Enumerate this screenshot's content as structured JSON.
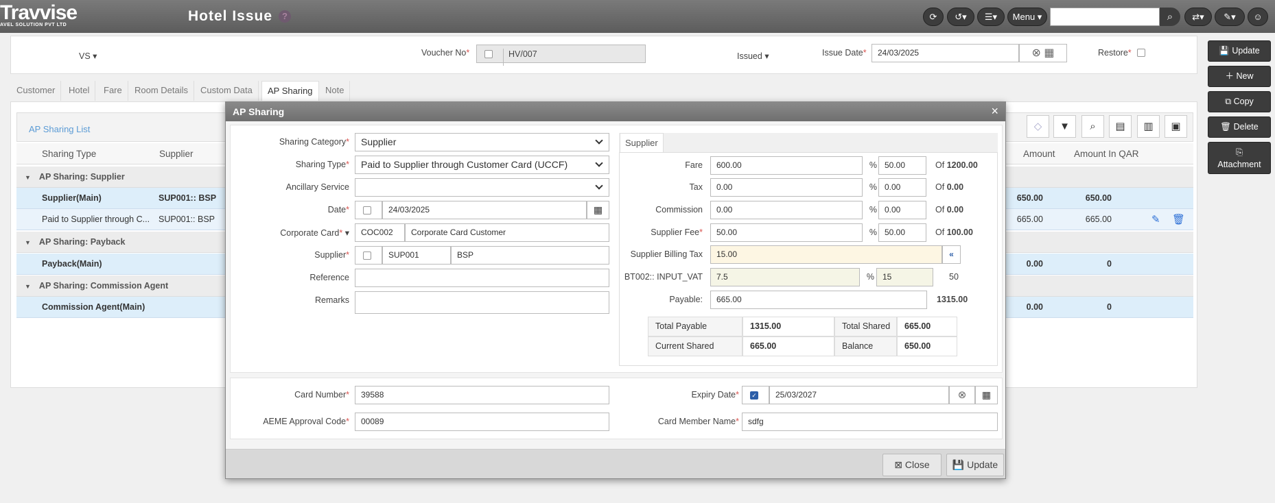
{
  "app": {
    "logo": "Travvise",
    "logo_sub": "AVEL SOLUTION PVT LTD",
    "title": "Hotel Issue",
    "help": "?",
    "menu_label": "Menu"
  },
  "header": {
    "vs": "VS",
    "voucher_label": "Voucher No",
    "voucher_value": "HV/007",
    "status": "Issued",
    "issue_date_label": "Issue Date",
    "issue_date": "24/03/2025",
    "restore_label": "Restore"
  },
  "tabs": [
    "Customer",
    "Hotel",
    "Fare",
    "Room Details",
    "Custom Data",
    "AP Sharing",
    "Note"
  ],
  "list": {
    "title": "AP Sharing List",
    "columns": [
      "Sharing Type",
      "Supplier",
      "Amount",
      "Amount In QAR"
    ],
    "groups": [
      {
        "label": "AP Sharing: Supplier"
      },
      {
        "label": "AP Sharing: Payback"
      },
      {
        "label": "AP Sharing: Commission Agent"
      }
    ],
    "rows": [
      {
        "type": "Supplier(Main)",
        "supplier": "SUP001:: BSP",
        "amount": "650.00",
        "qar": "650.00"
      },
      {
        "type": "Paid to Supplier through C...",
        "supplier": "SUP001:: BSP",
        "amount": "665.00",
        "qar": "665.00"
      },
      {
        "type": "Payback(Main)",
        "supplier": "",
        "amount": "0.00",
        "qar": "0"
      },
      {
        "type": "Commission Agent(Main)",
        "supplier": "",
        "amount": "0.00",
        "qar": "0"
      }
    ]
  },
  "side_buttons": {
    "update": "Update",
    "new": "New",
    "copy": "Copy",
    "delete": "Delete",
    "attachment": "Attachment"
  },
  "modal": {
    "title": "AP Sharing",
    "close_x": "×",
    "left": {
      "sharing_category_label": "Sharing Category",
      "sharing_category": "Supplier",
      "sharing_type_label": "Sharing Type",
      "sharing_type": "Paid to Supplier through Customer Card (UCCF)",
      "ancillary_label": "Ancillary Service",
      "ancillary": "",
      "date_label": "Date",
      "date": "24/03/2025",
      "corp_card_label": "Corporate Card",
      "corp_card_code": "COC002",
      "corp_card_name": "Corporate Card Customer",
      "supplier_label": "Supplier",
      "supplier_code": "SUP001",
      "supplier_name": "BSP",
      "reference_label": "Reference",
      "reference": "",
      "remarks_label": "Remarks",
      "remarks": ""
    },
    "right": {
      "tab": "Supplier",
      "fare_label": "Fare",
      "fare": "600.00",
      "fare_pct": "50.00",
      "fare_of": "1200.00",
      "tax_label": "Tax",
      "tax": "0.00",
      "tax_pct": "0.00",
      "tax_of": "0.00",
      "commission_label": "Commission",
      "commission": "0.00",
      "commission_pct": "0.00",
      "commission_of": "0.00",
      "supfee_label": "Supplier Fee",
      "supfee": "50.00",
      "supfee_pct": "50.00",
      "supfee_of": "100.00",
      "billing_tax_label": "Supplier Billing Tax",
      "billing_tax": "15.00",
      "vat_label": "BT002:: INPUT_VAT",
      "vat": "7.5",
      "vat_pct": "15",
      "vat_of": "50",
      "payable_label": "Payable:",
      "payable": "665.00",
      "payable_total": "1315.00",
      "of_label": "Of",
      "pct": "%",
      "total_payable_label": "Total Payable",
      "total_payable": "1315.00",
      "total_shared_label": "Total Shared",
      "total_shared": "665.00",
      "current_shared_label": "Current Shared",
      "current_shared": "665.00",
      "balance_label": "Balance",
      "balance": "650.00"
    },
    "card": {
      "card_number_label": "Card Number",
      "card_number": "39588",
      "approval_label": "AEME Approval Code",
      "approval": "00089",
      "expiry_label": "Expiry Date",
      "expiry": "25/03/2027",
      "member_label": "Card Member Name",
      "member": "sdfg"
    },
    "footer": {
      "close": "Close",
      "update": "Update"
    }
  }
}
